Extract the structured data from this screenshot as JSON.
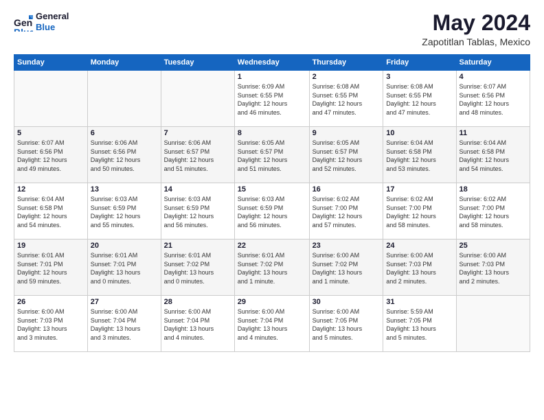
{
  "logo": {
    "line1": "General",
    "line2": "Blue"
  },
  "header": {
    "month_year": "May 2024",
    "location": "Zapotitlan Tablas, Mexico"
  },
  "weekdays": [
    "Sunday",
    "Monday",
    "Tuesday",
    "Wednesday",
    "Thursday",
    "Friday",
    "Saturday"
  ],
  "weeks": [
    [
      {
        "day": "",
        "info": ""
      },
      {
        "day": "",
        "info": ""
      },
      {
        "day": "",
        "info": ""
      },
      {
        "day": "1",
        "info": "Sunrise: 6:09 AM\nSunset: 6:55 PM\nDaylight: 12 hours\nand 46 minutes."
      },
      {
        "day": "2",
        "info": "Sunrise: 6:08 AM\nSunset: 6:55 PM\nDaylight: 12 hours\nand 47 minutes."
      },
      {
        "day": "3",
        "info": "Sunrise: 6:08 AM\nSunset: 6:55 PM\nDaylight: 12 hours\nand 47 minutes."
      },
      {
        "day": "4",
        "info": "Sunrise: 6:07 AM\nSunset: 6:56 PM\nDaylight: 12 hours\nand 48 minutes."
      }
    ],
    [
      {
        "day": "5",
        "info": "Sunrise: 6:07 AM\nSunset: 6:56 PM\nDaylight: 12 hours\nand 49 minutes."
      },
      {
        "day": "6",
        "info": "Sunrise: 6:06 AM\nSunset: 6:56 PM\nDaylight: 12 hours\nand 50 minutes."
      },
      {
        "day": "7",
        "info": "Sunrise: 6:06 AM\nSunset: 6:57 PM\nDaylight: 12 hours\nand 51 minutes."
      },
      {
        "day": "8",
        "info": "Sunrise: 6:05 AM\nSunset: 6:57 PM\nDaylight: 12 hours\nand 51 minutes."
      },
      {
        "day": "9",
        "info": "Sunrise: 6:05 AM\nSunset: 6:57 PM\nDaylight: 12 hours\nand 52 minutes."
      },
      {
        "day": "10",
        "info": "Sunrise: 6:04 AM\nSunset: 6:58 PM\nDaylight: 12 hours\nand 53 minutes."
      },
      {
        "day": "11",
        "info": "Sunrise: 6:04 AM\nSunset: 6:58 PM\nDaylight: 12 hours\nand 54 minutes."
      }
    ],
    [
      {
        "day": "12",
        "info": "Sunrise: 6:04 AM\nSunset: 6:58 PM\nDaylight: 12 hours\nand 54 minutes."
      },
      {
        "day": "13",
        "info": "Sunrise: 6:03 AM\nSunset: 6:59 PM\nDaylight: 12 hours\nand 55 minutes."
      },
      {
        "day": "14",
        "info": "Sunrise: 6:03 AM\nSunset: 6:59 PM\nDaylight: 12 hours\nand 56 minutes."
      },
      {
        "day": "15",
        "info": "Sunrise: 6:03 AM\nSunset: 6:59 PM\nDaylight: 12 hours\nand 56 minutes."
      },
      {
        "day": "16",
        "info": "Sunrise: 6:02 AM\nSunset: 7:00 PM\nDaylight: 12 hours\nand 57 minutes."
      },
      {
        "day": "17",
        "info": "Sunrise: 6:02 AM\nSunset: 7:00 PM\nDaylight: 12 hours\nand 58 minutes."
      },
      {
        "day": "18",
        "info": "Sunrise: 6:02 AM\nSunset: 7:00 PM\nDaylight: 12 hours\nand 58 minutes."
      }
    ],
    [
      {
        "day": "19",
        "info": "Sunrise: 6:01 AM\nSunset: 7:01 PM\nDaylight: 12 hours\nand 59 minutes."
      },
      {
        "day": "20",
        "info": "Sunrise: 6:01 AM\nSunset: 7:01 PM\nDaylight: 13 hours\nand 0 minutes."
      },
      {
        "day": "21",
        "info": "Sunrise: 6:01 AM\nSunset: 7:02 PM\nDaylight: 13 hours\nand 0 minutes."
      },
      {
        "day": "22",
        "info": "Sunrise: 6:01 AM\nSunset: 7:02 PM\nDaylight: 13 hours\nand 1 minute."
      },
      {
        "day": "23",
        "info": "Sunrise: 6:00 AM\nSunset: 7:02 PM\nDaylight: 13 hours\nand 1 minute."
      },
      {
        "day": "24",
        "info": "Sunrise: 6:00 AM\nSunset: 7:03 PM\nDaylight: 13 hours\nand 2 minutes."
      },
      {
        "day": "25",
        "info": "Sunrise: 6:00 AM\nSunset: 7:03 PM\nDaylight: 13 hours\nand 2 minutes."
      }
    ],
    [
      {
        "day": "26",
        "info": "Sunrise: 6:00 AM\nSunset: 7:03 PM\nDaylight: 13 hours\nand 3 minutes."
      },
      {
        "day": "27",
        "info": "Sunrise: 6:00 AM\nSunset: 7:04 PM\nDaylight: 13 hours\nand 3 minutes."
      },
      {
        "day": "28",
        "info": "Sunrise: 6:00 AM\nSunset: 7:04 PM\nDaylight: 13 hours\nand 4 minutes."
      },
      {
        "day": "29",
        "info": "Sunrise: 6:00 AM\nSunset: 7:04 PM\nDaylight: 13 hours\nand 4 minutes."
      },
      {
        "day": "30",
        "info": "Sunrise: 6:00 AM\nSunset: 7:05 PM\nDaylight: 13 hours\nand 5 minutes."
      },
      {
        "day": "31",
        "info": "Sunrise: 5:59 AM\nSunset: 7:05 PM\nDaylight: 13 hours\nand 5 minutes."
      },
      {
        "day": "",
        "info": ""
      }
    ]
  ]
}
